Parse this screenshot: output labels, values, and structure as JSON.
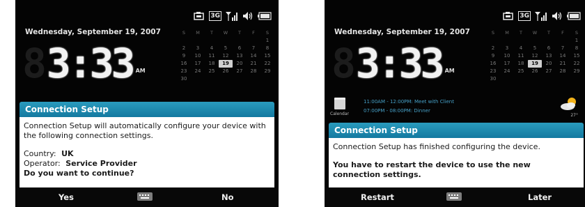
{
  "screen1": {
    "status": {
      "network": "3G"
    },
    "today": {
      "date": "Wednesday, September 19, 2007",
      "time": "3:33",
      "ampm": "AM"
    },
    "calendar": {
      "weekday_headers": [
        "S",
        "M",
        "T",
        "W",
        "T",
        "F",
        "S"
      ],
      "weeks": [
        [
          "",
          "",
          "",
          "",
          "",
          "",
          "1"
        ],
        [
          "2",
          "3",
          "4",
          "5",
          "6",
          "7",
          "8"
        ],
        [
          "9",
          "10",
          "11",
          "12",
          "13",
          "14",
          "15"
        ],
        [
          "16",
          "17",
          "18",
          "19",
          "20",
          "21",
          "22"
        ],
        [
          "23",
          "24",
          "25",
          "26",
          "27",
          "28",
          "29"
        ],
        [
          "30",
          "",
          "",
          "",
          "",
          "",
          ""
        ]
      ],
      "today": "19"
    },
    "dialog": {
      "title": "Connection Setup",
      "message": "Connection Setup will automatically configure your device with the following connection settings.",
      "country_label": "Country:",
      "country_value": "UK",
      "operator_label": "Operator:",
      "operator_value": "Service Provider",
      "question": "Do you want to continue?"
    },
    "softkeys": {
      "left": "Yes",
      "right": "No"
    }
  },
  "screen2": {
    "status": {
      "network": "3G"
    },
    "today": {
      "date": "Wednesday, September 19, 2007",
      "time": "3:33",
      "ampm": "AM"
    },
    "calendar": {
      "weekday_headers": [
        "S",
        "M",
        "T",
        "W",
        "T",
        "F",
        "S"
      ],
      "weeks": [
        [
          "",
          "",
          "",
          "",
          "",
          "",
          "1"
        ],
        [
          "2",
          "3",
          "4",
          "5",
          "6",
          "7",
          "8"
        ],
        [
          "9",
          "10",
          "11",
          "12",
          "13",
          "14",
          "15"
        ],
        [
          "16",
          "17",
          "18",
          "19",
          "20",
          "21",
          "22"
        ],
        [
          "23",
          "24",
          "25",
          "26",
          "27",
          "28",
          "29"
        ],
        [
          "30",
          "",
          "",
          "",
          "",
          "",
          ""
        ]
      ],
      "today": "19"
    },
    "appointments": [
      "11:00AM - 12:00PM: Meet with Client",
      "07:00PM - 08:00PM: Dinner"
    ],
    "calendar_icon_label": "Calendar",
    "weather_temp": "27°",
    "dialog": {
      "title": "Connection Setup",
      "message": "Connection Setup has finished configuring the device.",
      "restart_message": "You have to restart the device to use the new connection settings."
    },
    "softkeys": {
      "left": "Restart",
      "right": "Later"
    }
  },
  "colors": {
    "dialog_title_bar": "#1d86ad",
    "appointment_text": "#46a0c7",
    "screen_background": "#040404"
  }
}
